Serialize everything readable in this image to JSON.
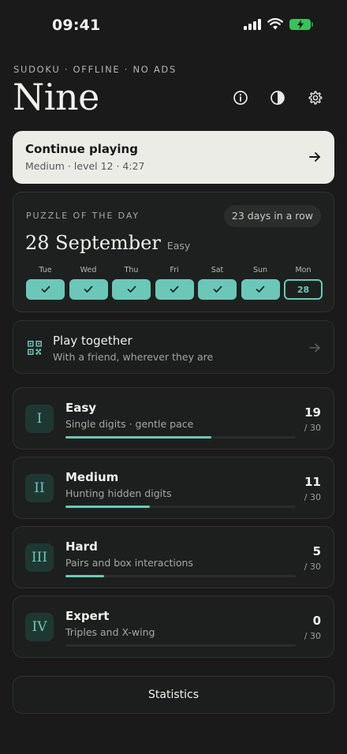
{
  "status_bar": {
    "time": "09:41"
  },
  "header": {
    "eyebrow": "SUDOKU · OFFLINE · NO ADS",
    "title": "Nine"
  },
  "continue": {
    "title": "Continue playing",
    "subtitle": "Medium · level 12 · 4:27"
  },
  "daily": {
    "label": "PUZZLE OF THE DAY",
    "streak": "23 days in a row",
    "date": "28 September",
    "difficulty": "Easy",
    "week": [
      {
        "day": "Tue",
        "done": true
      },
      {
        "day": "Wed",
        "done": true
      },
      {
        "day": "Thu",
        "done": true
      },
      {
        "day": "Fri",
        "done": true
      },
      {
        "day": "Sat",
        "done": true
      },
      {
        "day": "Sun",
        "done": true
      },
      {
        "day": "Mon",
        "date": "28",
        "today": true
      }
    ]
  },
  "play_together": {
    "title": "Play together",
    "subtitle": "With a friend, wherever they are",
    "icon": "qr-code-icon"
  },
  "levels": [
    {
      "numeral": "I",
      "name": "Easy",
      "desc": "Single digits · gentle pace",
      "done": "19",
      "total": "/ 30",
      "progress": 0.633
    },
    {
      "numeral": "II",
      "name": "Medium",
      "desc": "Hunting hidden digits",
      "done": "11",
      "total": "/ 30",
      "progress": 0.367
    },
    {
      "numeral": "III",
      "name": "Hard",
      "desc": "Pairs and box interactions",
      "done": "5",
      "total": "/ 30",
      "progress": 0.167
    },
    {
      "numeral": "IV",
      "name": "Expert",
      "desc": "Triples and X-wing",
      "done": "0",
      "total": "/ 30",
      "progress": 0
    }
  ],
  "statistics_label": "Statistics",
  "colors": {
    "background": "#191a19",
    "accent": "#6bc8b8",
    "card": "#1d1f1e",
    "continue_card": "#ecece7",
    "battery": "#36c45a"
  }
}
